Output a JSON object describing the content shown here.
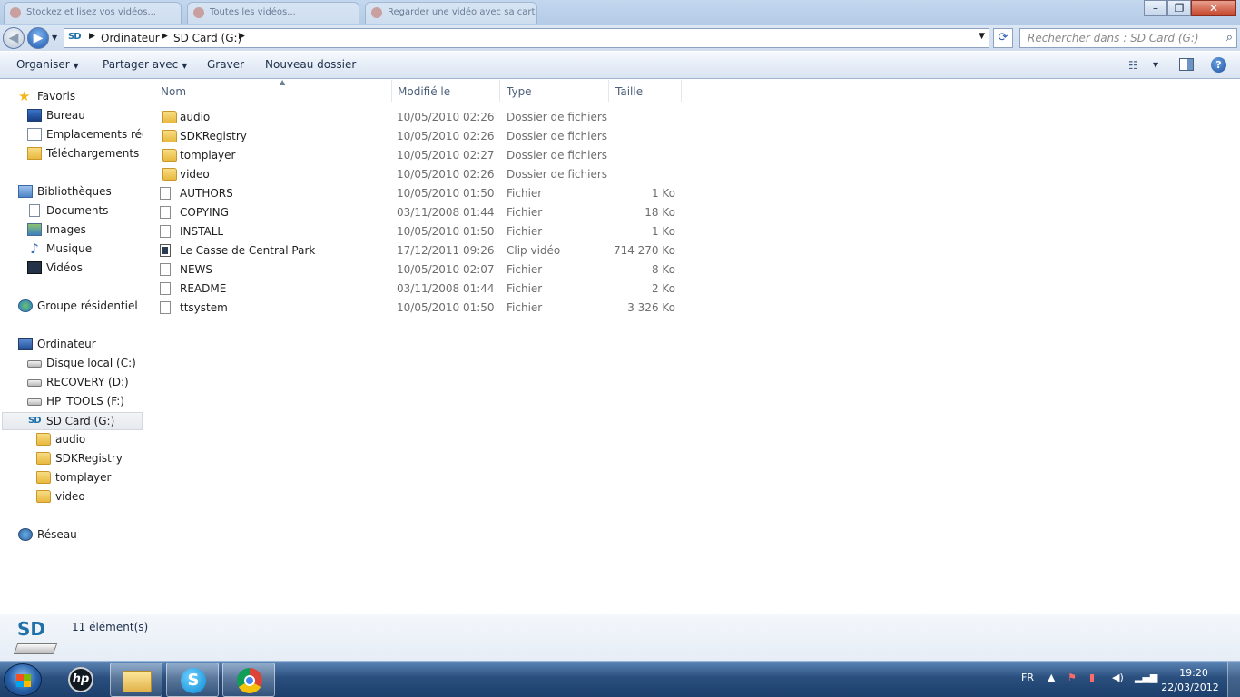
{
  "window": {
    "bg_tabs": [
      "Stockez et lisez vos vidéos...",
      "Toutes les vidéos...",
      "Regarder une vidéo avec sa carte SD..."
    ]
  },
  "address": {
    "crumbs": [
      "Ordinateur",
      "SD Card (G:)"
    ],
    "search_placeholder": "Rechercher dans : SD Card (G:)"
  },
  "toolbar": {
    "organise": "Organiser",
    "share": "Partager avec",
    "burn": "Graver",
    "new_folder": "Nouveau dossier"
  },
  "nav": {
    "favorites": "Favoris",
    "desktop": "Bureau",
    "recent": "Emplacements récents",
    "downloads": "Téléchargements",
    "libraries": "Bibliothèques",
    "documents": "Documents",
    "images": "Images",
    "music": "Musique",
    "videos": "Vidéos",
    "homegroup": "Groupe résidentiel",
    "computer": "Ordinateur",
    "drive_c": "Disque local (C:)",
    "drive_d": "RECOVERY (D:)",
    "drive_f": "HP_TOOLS (F:)",
    "drive_g": "SD Card (G:)",
    "sub": [
      "audio",
      "SDKRegistry",
      "tomplayer",
      "video"
    ],
    "network": "Réseau"
  },
  "columns": {
    "name": "Nom",
    "modified": "Modifié le",
    "type": "Type",
    "size": "Taille"
  },
  "files": [
    {
      "icon": "folder-icon",
      "name": "audio",
      "date": "10/05/2010 02:26",
      "type": "Dossier de fichiers",
      "size": ""
    },
    {
      "icon": "folder-icon",
      "name": "SDKRegistry",
      "date": "10/05/2010 02:26",
      "type": "Dossier de fichiers",
      "size": ""
    },
    {
      "icon": "folder-icon",
      "name": "tomplayer",
      "date": "10/05/2010 02:27",
      "type": "Dossier de fichiers",
      "size": ""
    },
    {
      "icon": "folder-icon",
      "name": "video",
      "date": "10/05/2010 02:26",
      "type": "Dossier de fichiers",
      "size": ""
    },
    {
      "icon": "file-icon",
      "name": "AUTHORS",
      "date": "10/05/2010 01:50",
      "type": "Fichier",
      "size": "1 Ko"
    },
    {
      "icon": "file-icon",
      "name": "COPYING",
      "date": "03/11/2008 01:44",
      "type": "Fichier",
      "size": "18 Ko"
    },
    {
      "icon": "file-icon",
      "name": "INSTALL",
      "date": "10/05/2010 01:50",
      "type": "Fichier",
      "size": "1 Ko"
    },
    {
      "icon": "video-file-icon",
      "name": "Le Casse de Central Park",
      "date": "17/12/2011 09:26",
      "type": "Clip vidéo",
      "size": "714 270 Ko"
    },
    {
      "icon": "file-icon",
      "name": "NEWS",
      "date": "10/05/2010 02:07",
      "type": "Fichier",
      "size": "8 Ko"
    },
    {
      "icon": "file-icon",
      "name": "README",
      "date": "03/11/2008 01:44",
      "type": "Fichier",
      "size": "2 Ko"
    },
    {
      "icon": "file-icon",
      "name": "ttsystem",
      "date": "10/05/2010 01:50",
      "type": "Fichier",
      "size": "3 326 Ko"
    }
  ],
  "details": {
    "drive_logo": "SD",
    "count": "11 élément(s)"
  },
  "taskbar": {
    "lang": "FR",
    "time": "19:20",
    "date": "22/03/2012",
    "hp_label": "hp",
    "skype_label": "S"
  }
}
